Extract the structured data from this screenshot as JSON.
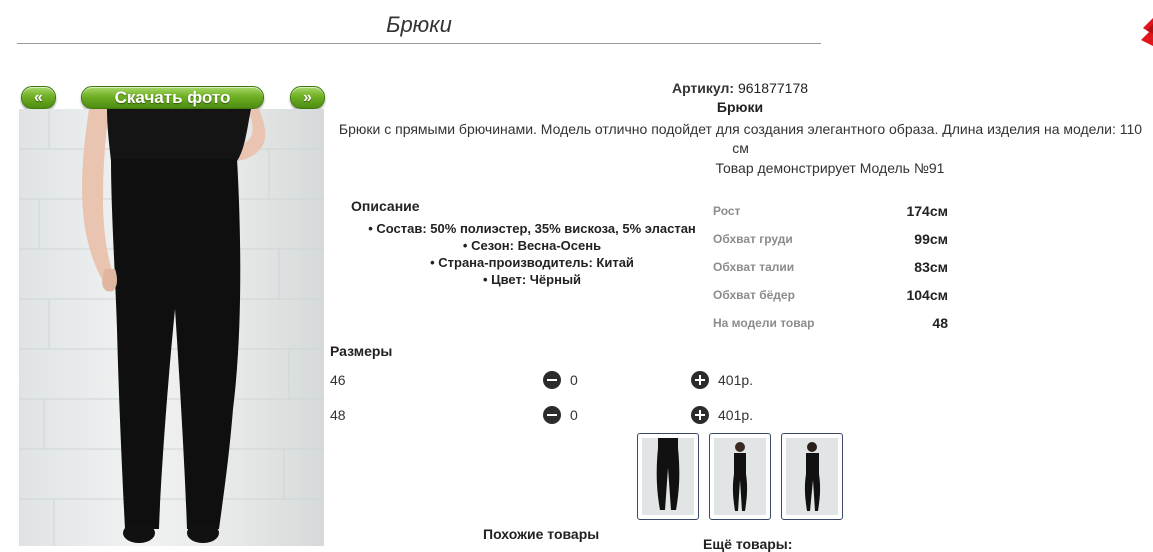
{
  "page": {
    "title": "Брюки"
  },
  "gallery": {
    "prev_label": "«",
    "download_label": "Скачать фото",
    "next_label": "»"
  },
  "product": {
    "article_label": "Артикул:",
    "article_value": "961877178",
    "name": "Брюки",
    "description": "Брюки с прямыми брючинами. Модель отлично подойдет для создания элегантного образа. Длина изделия на модели: 110 см",
    "model_caption": "Товар демонстрирует Модель №91"
  },
  "specs": {
    "heading": "Описание",
    "items": [
      "Состав: 50% полиэстер, 35% вискоза, 5% эластан",
      "Сезон: Весна-Осень",
      "Страна-производитель: Китай",
      "Цвет: Чёрный"
    ]
  },
  "model": {
    "rows": [
      {
        "label": "Рост",
        "value": "174см"
      },
      {
        "label": "Обхват груди",
        "value": "99см"
      },
      {
        "label": "Обхват талии",
        "value": "83см"
      },
      {
        "label": "Обхват бёдер",
        "value": "104см"
      },
      {
        "label": "На модели товар",
        "value": "48"
      }
    ]
  },
  "sizes": {
    "heading": "Размеры",
    "rows": [
      {
        "size": "46",
        "qty": "0",
        "price": "401р."
      },
      {
        "size": "48",
        "qty": "0",
        "price": "401р."
      }
    ]
  },
  "footer": {
    "similar_heading": "Похожие товары",
    "more_heading": "Ещё товары:"
  },
  "colors": {
    "button_green": "#6fb023",
    "close_red": "#e0161c"
  }
}
